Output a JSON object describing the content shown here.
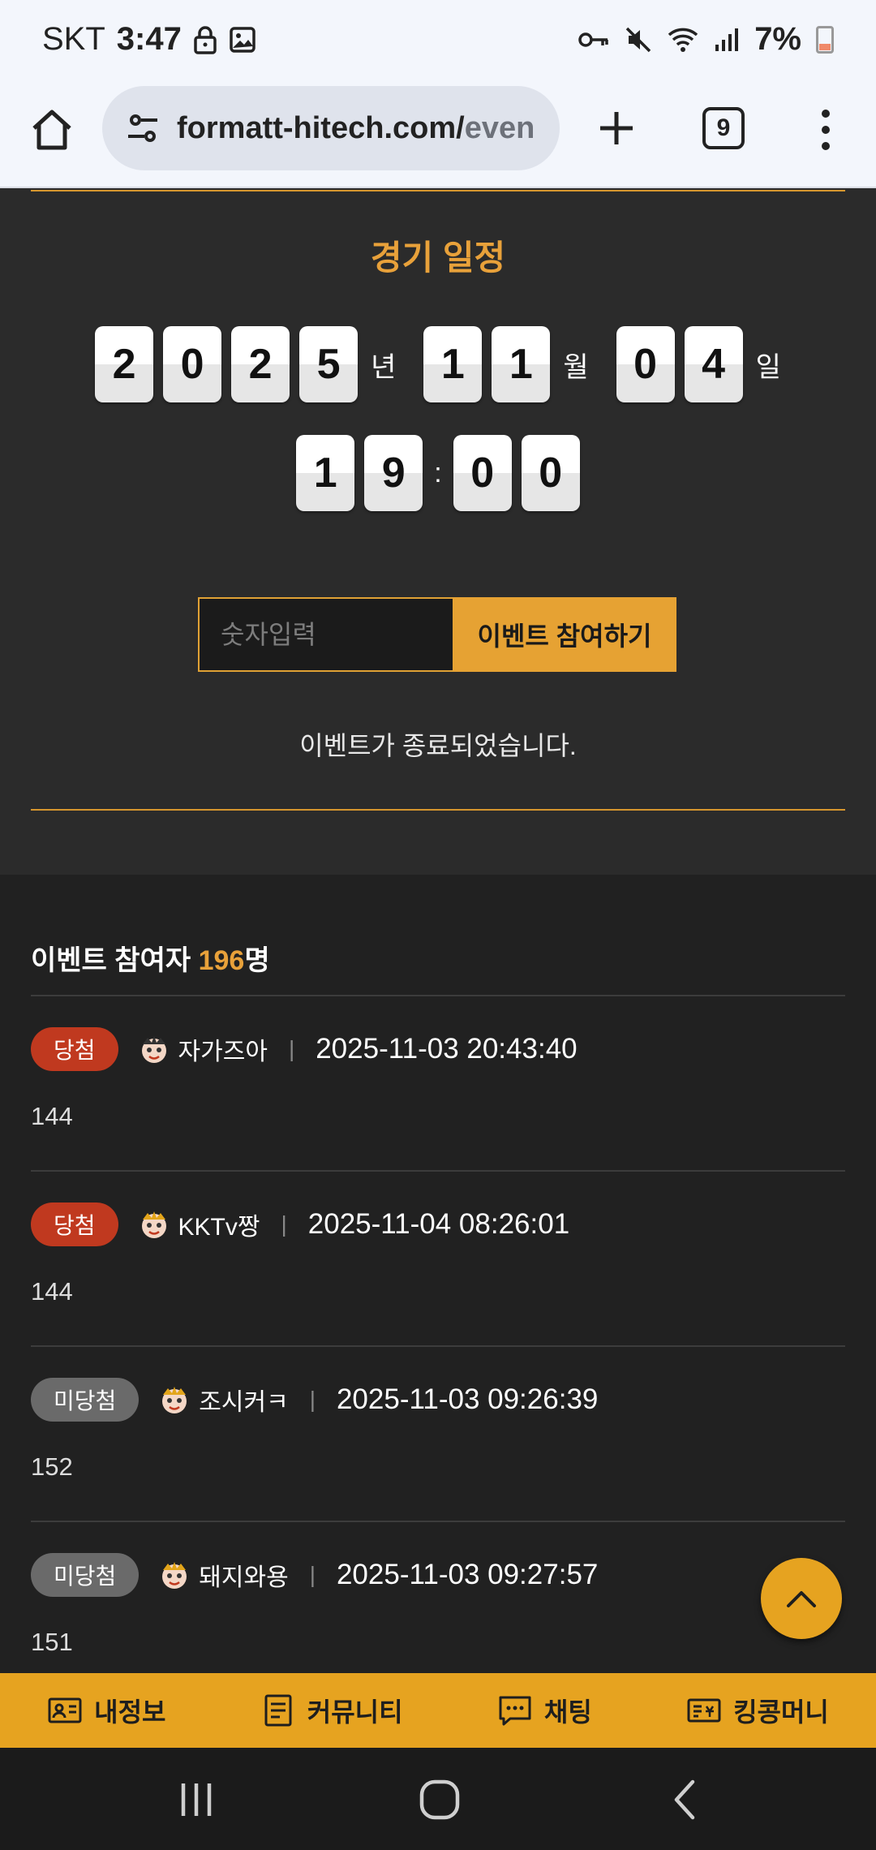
{
  "status_bar": {
    "carrier": "SKT",
    "time": "3:47",
    "battery": "7%"
  },
  "browser": {
    "url_main": "formatt-hitech.com/",
    "url_tail": "even",
    "tab_count": "9"
  },
  "event": {
    "title": "경기 일정",
    "date_digits": {
      "year": [
        "2",
        "0",
        "2",
        "5"
      ],
      "month": [
        "1",
        "1"
      ],
      "day": [
        "0",
        "4"
      ],
      "hour": [
        "1",
        "9"
      ],
      "minute": [
        "0",
        "0"
      ]
    },
    "units": {
      "year": "년",
      "month": "월",
      "day": "일",
      "colon": ":"
    },
    "input_placeholder": "숫자입력",
    "join_button": "이벤트 참여하기",
    "ended_message": "이벤트가 종료되었습니다."
  },
  "participants": {
    "title_prefix": "이벤트 참여자 ",
    "count": "196",
    "title_suffix": "명",
    "entries": [
      {
        "status": "당첨",
        "status_type": "win",
        "nickname": "자가즈아",
        "timestamp": "2025-11-03 20:43:40",
        "value": "144"
      },
      {
        "status": "당첨",
        "status_type": "win",
        "nickname": "KKTv짱",
        "timestamp": "2025-11-04 08:26:01",
        "value": "144"
      },
      {
        "status": "미당첨",
        "status_type": "lose",
        "nickname": "조시커ㅋ",
        "timestamp": "2025-11-03 09:26:39",
        "value": "152"
      },
      {
        "status": "미당첨",
        "status_type": "lose",
        "nickname": "돼지와용",
        "timestamp": "2025-11-03 09:27:57",
        "value": "151"
      }
    ],
    "separator": "|"
  },
  "bottom_nav": [
    {
      "label": "내정보",
      "icon": "id-card-icon"
    },
    {
      "label": "커뮤니티",
      "icon": "document-icon"
    },
    {
      "label": "채팅",
      "icon": "chat-bubble-icon"
    },
    {
      "label": "킹콩머니",
      "icon": "money-card-icon"
    }
  ],
  "colors": {
    "accent": "#e6a320",
    "win_badge": "#c0391f",
    "lose_badge": "#6a6a6a",
    "panel": "#2b2b2b",
    "background": "#212121"
  }
}
